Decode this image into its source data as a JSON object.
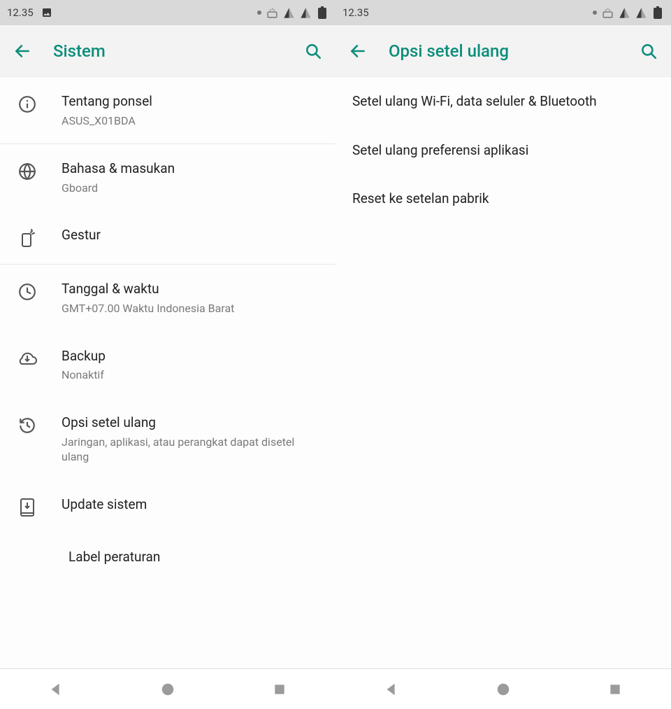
{
  "status": {
    "time": "12.35"
  },
  "left_screen": {
    "header": {
      "title": "Sistem"
    },
    "items": [
      {
        "title": "Tentang ponsel",
        "subtitle": "ASUS_X01BDA"
      },
      {
        "title": "Bahasa & masukan",
        "subtitle": "Gboard"
      },
      {
        "title": "Gestur",
        "subtitle": ""
      },
      {
        "title": "Tanggal & waktu",
        "subtitle": "GMT+07.00 Waktu Indonesia Barat"
      },
      {
        "title": "Backup",
        "subtitle": "Nonaktif"
      },
      {
        "title": "Opsi setel ulang",
        "subtitle": "Jaringan, aplikasi, atau perangkat dapat disetel ulang"
      },
      {
        "title": "Update sistem",
        "subtitle": ""
      },
      {
        "title": "Label peraturan",
        "subtitle": ""
      }
    ]
  },
  "right_screen": {
    "header": {
      "title": "Opsi setel ulang"
    },
    "items": [
      {
        "title": "Setel ulang Wi-Fi, data seluler & Bluetooth"
      },
      {
        "title": "Setel ulang preferensi aplikasi"
      },
      {
        "title": "Reset ke setelan pabrik"
      }
    ]
  }
}
